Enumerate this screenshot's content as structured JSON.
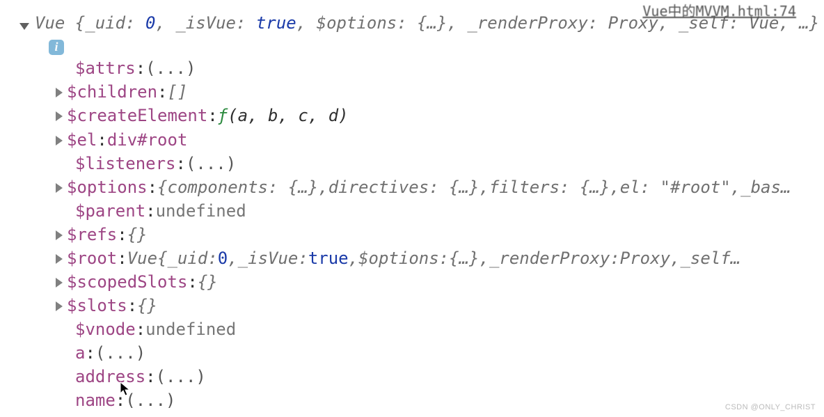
{
  "source_ref": "Vue中的MVVM.html:74",
  "watermark": "CSDN @ONLY_CHRIST",
  "header": {
    "class_name": "Vue ",
    "open": "{",
    "parts": [
      {
        "k": "_uid",
        "sep": ": ",
        "v": "0",
        "vcls": "blue-num"
      },
      {
        "k": "_isVue",
        "sep": ": ",
        "v": "true",
        "vcls": "blue-num"
      },
      {
        "k": "$options",
        "sep": ": ",
        "v": "{…}",
        "vcls": "obj-gray"
      },
      {
        "k": "_renderProxy",
        "sep": ": ",
        "v": "Proxy",
        "vcls": "obj-gray"
      },
      {
        "k": "_self",
        "sep": ": ",
        "v": "Vue",
        "vcls": "obj-gray"
      }
    ],
    "trail": ", …}"
  },
  "info_glyph": "i",
  "props": [
    {
      "expandable": false,
      "key": "$attrs",
      "value_display": "(...)",
      "valcls": "ellipsis"
    },
    {
      "expandable": true,
      "key": "$children",
      "value_display": "[]",
      "valcls": "obj-gray"
    },
    {
      "expandable": true,
      "key": "$createElement",
      "fn": true,
      "fn_sig": " (a, b, c, d)"
    },
    {
      "expandable": true,
      "key": "$el",
      "value_display": "div#root",
      "valcls": "purple"
    },
    {
      "expandable": false,
      "key": "$listeners",
      "value_display": "(...)",
      "valcls": "ellipsis"
    },
    {
      "expandable": true,
      "key": "$options",
      "obj_preview": {
        "parts": [
          "components: {…}",
          "directives: {…}",
          "filters: {…}",
          "el: \"#root\"",
          "_bas…"
        ],
        "truncated": true
      }
    },
    {
      "expandable": false,
      "key": "$parent",
      "value_display": "undefined",
      "valcls": "val-gray"
    },
    {
      "expandable": true,
      "key": "$refs",
      "value_display": "{}",
      "valcls": "obj-gray"
    },
    {
      "expandable": true,
      "key": "$root",
      "root_preview": {
        "cls": "Vue",
        "parts": [
          {
            "k": "_uid",
            "v": "0",
            "vcls": "blue-num"
          },
          {
            "k": "_isVue",
            "v": "true",
            "vcls": "blue-num"
          },
          {
            "k": "$options",
            "v": "{…}",
            "vcls": "obj-gray"
          },
          {
            "k": "_renderProxy",
            "v": "Proxy",
            "vcls": "obj-gray"
          },
          {
            "k": "_self…",
            "v": "",
            "vcls": ""
          }
        ]
      }
    },
    {
      "expandable": true,
      "key": "$scopedSlots",
      "value_display": "{}",
      "valcls": "obj-gray"
    },
    {
      "expandable": true,
      "key": "$slots",
      "value_display": "{}",
      "valcls": "obj-gray"
    },
    {
      "expandable": false,
      "key": "$vnode",
      "value_display": "undefined",
      "valcls": "val-gray"
    },
    {
      "expandable": false,
      "key": "a",
      "value_display": "(...)",
      "valcls": "ellipsis"
    },
    {
      "expandable": false,
      "key": "address",
      "value_display": "(...)",
      "valcls": "ellipsis"
    },
    {
      "expandable": false,
      "key": "name",
      "value_display": "(...)",
      "valcls": "ellipsis"
    }
  ],
  "colon": ": ",
  "comma": ", ",
  "fn_glyph": "ƒ",
  "brace_open": "{",
  "brace_close": "}"
}
